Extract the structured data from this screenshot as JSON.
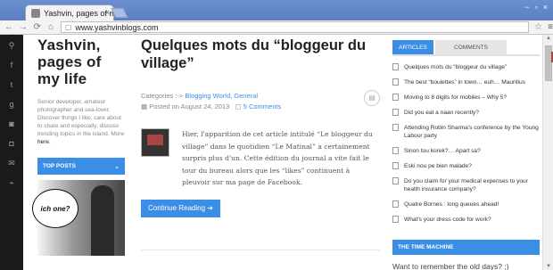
{
  "browser": {
    "tab_title": "Yashvin, pages of my life",
    "tab_close": "×",
    "url": "www.yashvinblogs.com",
    "window_controls": [
      "−",
      "▫",
      "×"
    ]
  },
  "social_icons": [
    "search-icon",
    "facebook-icon",
    "twitter-icon",
    "google-plus-icon",
    "instagram-icon",
    "camera-icon",
    "mail-icon",
    "rss-icon"
  ],
  "sidebar": {
    "site_title": "Yashvin, pages of my life",
    "bio_text": "Senior developer, amateur photographer and sea-lover. Discover things I like, care about to share and especially, discuss trending topics in the island. More",
    "bio_link": "here",
    "top_posts_label": "TOP POSTS",
    "image_bubble_text": "ich one?"
  },
  "post": {
    "title": "Quelques mots du “bloggeur du village”",
    "categories_prefix": "Categories :-> ",
    "categories": "Blogging World, General",
    "posted_on": "Posted on August 24, 2013",
    "comments": "5 Comments",
    "excerpt": "Hier, l'apparition de cet article intitulé “Le bloggeur du village” dans le quotidien “Le Matinal” a certainement surpris plus d'un. Cette édition du journal a vite fait le tour du bureau alors que les “likes” continuent à pleuvoir sur ma page de Facebook.",
    "continue_label": "Continue Reading ➔"
  },
  "right_sidebar": {
    "tab_articles": "ARTICLES",
    "tab_comments": "COMMENTS",
    "articles": [
      "Quelques mots du “bloggeur du village”",
      "The best “boulettes” in town… euh… Mauritius",
      "Moving to 8 digits for mobiles – Why 5?",
      "Did you eat a naan recently?",
      "Attending Robin Sharma's conference by the Young Labour party",
      "Sinon tou korek?… Apart sa?",
      "Eski nou pe bien malade?",
      "Do you claim for your medical expenses to your health insurance company?",
      "Quatre Bornes : long queues ahead!",
      "What's your dress code for work?"
    ],
    "time_machine_label": "THE TIME MACHINE",
    "old_days_text": "Want to remember the old days? ;)"
  },
  "colors": {
    "accent": "#3a8ee6",
    "chrome": "#5a7fc0"
  }
}
